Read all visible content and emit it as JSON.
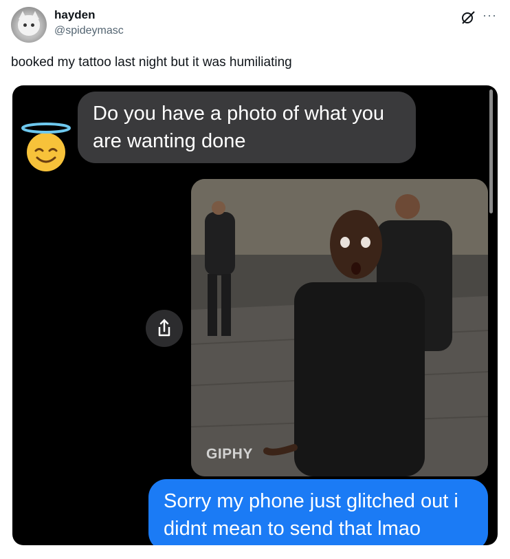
{
  "tweet": {
    "display_name": "hayden",
    "handle": "@spideymasc",
    "text": "booked my tattoo last night but it was humiliating",
    "more_label": "···"
  },
  "chat": {
    "incoming_message": "Do you have a photo of what you are wanting done",
    "outgoing_message": "Sorry my phone just glitched out i didnt mean to send that lmao",
    "gif_watermark": "GIPHY",
    "incoming_color": "#3a3a3c",
    "outgoing_color": "#1b7bf5"
  },
  "icons": {
    "avatar": "cat-avatar",
    "grok": "grok-icon",
    "more": "more-icon",
    "emoji": "smiling-face-with-halo-emoji",
    "share": "share-icon"
  }
}
